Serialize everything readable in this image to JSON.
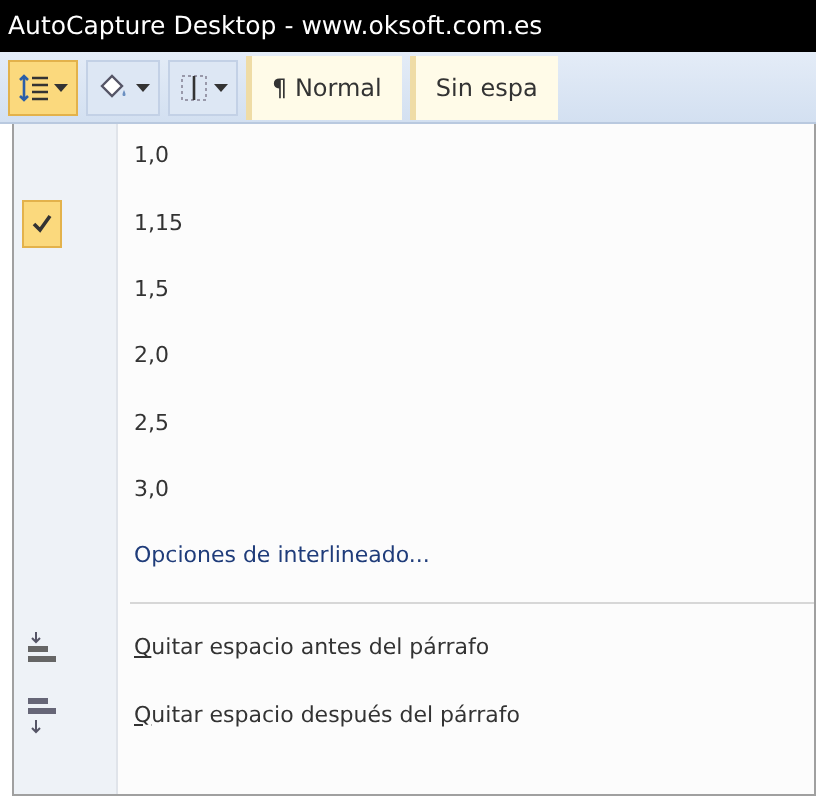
{
  "window": {
    "title": "AutoCapture Desktop - www.oksoft.com.es"
  },
  "toolbar": {
    "buttons": [
      {
        "kind": "line-spacing",
        "selected": true
      },
      {
        "kind": "shading",
        "selected": false
      },
      {
        "kind": "borders",
        "selected": false
      }
    ],
    "styles": [
      {
        "mark": "¶",
        "label": "Normal"
      },
      {
        "label": "Sin espa"
      }
    ]
  },
  "menu": {
    "items": [
      {
        "kind": "option",
        "label": "1,0",
        "selected": false
      },
      {
        "kind": "option",
        "label": "1,15",
        "selected": true
      },
      {
        "kind": "option",
        "label": "1,5",
        "selected": false
      },
      {
        "kind": "option",
        "label": "2,0",
        "selected": false
      },
      {
        "kind": "option",
        "label": "2,5",
        "selected": false
      },
      {
        "kind": "option",
        "label": "3,0",
        "selected": false
      },
      {
        "kind": "link",
        "label": "Opciones de interlineado..."
      },
      {
        "kind": "separator"
      },
      {
        "kind": "command",
        "label": "Quitar espacio antes del párrafo",
        "access_key": true
      },
      {
        "kind": "command",
        "label": "Quitar espacio después del párrafo",
        "access_key": true
      }
    ]
  }
}
